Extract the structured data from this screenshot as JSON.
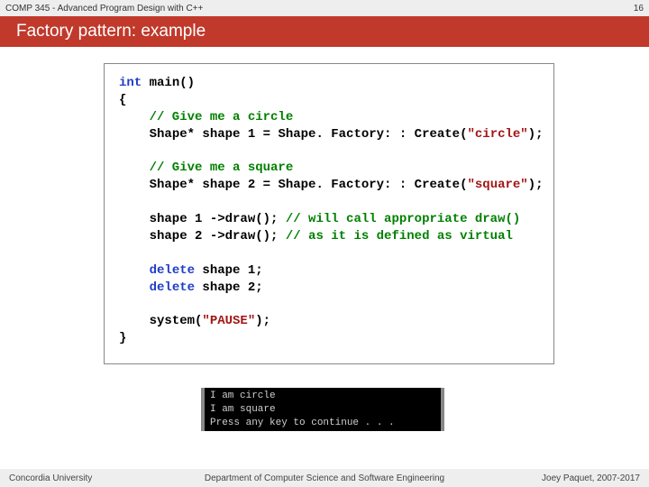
{
  "header": {
    "course": "COMP 345 - Advanced Program Design with C++",
    "page_number": "16"
  },
  "title": "Factory pattern: example",
  "code": {
    "kw_int": "int",
    "main_sig": " main()",
    "brace_open": "{",
    "comment_circle": "    // Give me a circle",
    "indent": "    ",
    "shape_star": "Shape* ",
    "s1_var": "shape 1 = ",
    "s2_var": "shape 2 = ",
    "factory_call_open": "Shape. Factory: : Create(",
    "arg_circle": "\"circle\"",
    "arg_square": "\"square\"",
    "close_paren": ");",
    "comment_square": "    // Give me a square",
    "s1_draw": "    shape 1 ->draw(); ",
    "draw_c1": "// will call appropriate draw()",
    "s2_draw": "    shape 2 ->draw(); ",
    "draw_c2": "// as it is defined as virtual",
    "kw_delete": "delete",
    "del_s1": " shape 1;",
    "del_s2": " shape 2;",
    "sys_call": "    system(",
    "pause": "\"PAUSE\"",
    "brace_close": "}"
  },
  "console": {
    "line1": "I am circle",
    "line2": "I am square",
    "line3": "Press any key to continue . . ."
  },
  "footer": {
    "left": "Concordia University",
    "mid": "Department of Computer Science and Software Engineering",
    "right": "Joey Paquet, 2007-2017"
  }
}
